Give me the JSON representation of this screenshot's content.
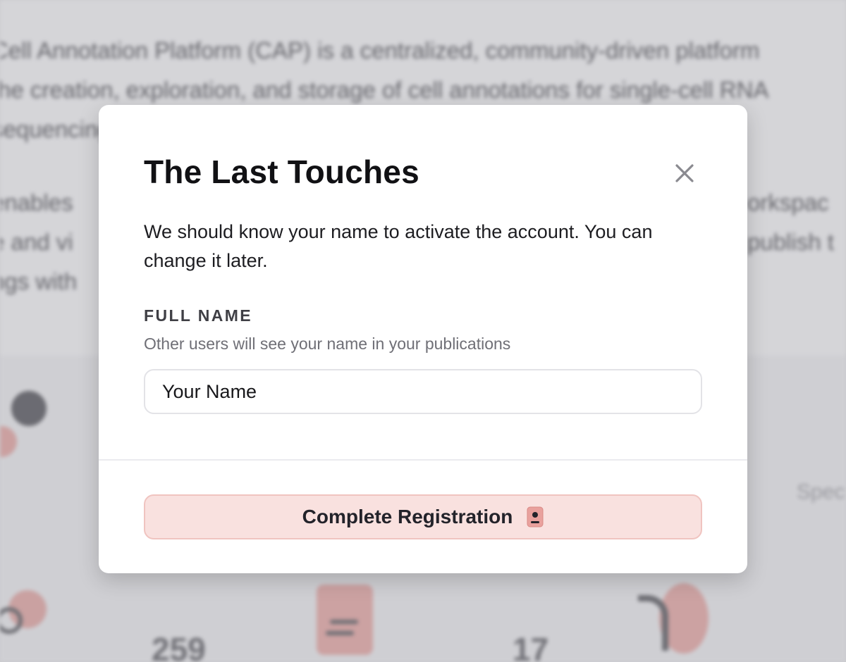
{
  "background": {
    "intro_line_1": "Cell Annotation Platform (CAP) is a centralized, community-driven platform",
    "intro_line_2": "the creation, exploration, and storage of cell annotations for single-cell RNA",
    "intro_line_3": "sequencing (s",
    "second_line_1": "enables",
    "second_line_2": "e and vi",
    "second_line_3": "ngs with",
    "side_fragment_1": "orkspac",
    "side_fragment_2": "publish t",
    "spec_label": "Spec",
    "stat_1": "259",
    "stat_2": "17"
  },
  "modal": {
    "title": "The Last Touches",
    "description": "We should know your name to activate the account. You can change it later.",
    "field": {
      "label": "FULL NAME",
      "hint": "Other users will see your name in your publications",
      "placeholder": "Your Name",
      "value": ""
    },
    "submit_label": "Complete Registration",
    "submit_icon": "id-badge-icon",
    "close_icon": "close-icon"
  },
  "colors": {
    "accent_bg": "#f9e1df",
    "accent_border": "#f0c4c0",
    "text_primary": "#111114"
  }
}
